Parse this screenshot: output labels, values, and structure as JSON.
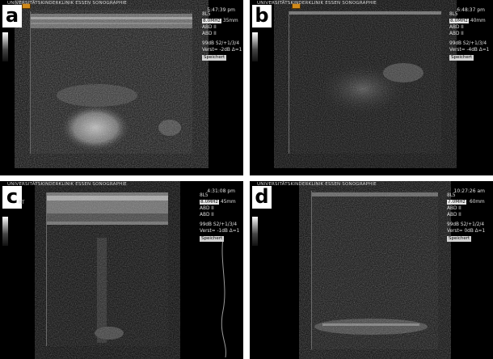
{
  "header_text": "UNIVERSITÄTSKINDERKLINIK ESSEN SONOGRAPHIE",
  "panels": [
    {
      "letter": "a",
      "time": "5:47:39 pm",
      "probe": "8L5",
      "freq": "8.0MHz",
      "depth": "35mm",
      "preset1": "ABD II",
      "preset2": "ABD II",
      "gain": "99dB",
      "s_setting": "S2/+1/3/4",
      "verst": "Verst= -2dB",
      "delta": "Δ=1",
      "saved": "Speichert"
    },
    {
      "letter": "b",
      "time": "6:48:37 pm",
      "probe": "8L5",
      "freq": "8.0MHz",
      "depth": "40mm",
      "preset1": "ABD II",
      "preset2": "ABD II",
      "gain": "99dB",
      "s_setting": "S2/+1/3/4",
      "verst": "Verst= -4dB",
      "delta": "Δ=1",
      "saved": "Speichert"
    },
    {
      "letter": "c",
      "rt": "RT",
      "time": "4:31:08 pm",
      "probe": "8L5",
      "freq": "8.0MHz",
      "depth": "45mm",
      "preset1": "ABD II",
      "preset2": "ABD II",
      "gain": "99dB",
      "s_setting": "S2/+1/3/4",
      "verst": "Verst= -1dB",
      "delta": "Δ=1",
      "saved": "Speichert"
    },
    {
      "letter": "d",
      "time": "10:27:26 am",
      "probe": "8L5",
      "freq": "7.0MHz",
      "depth": "60mm",
      "preset1": "ABD II",
      "preset2": "ABD II",
      "gain": "99dB",
      "s_setting": "S2/+1/2/4",
      "verst": "Verst= 0dB",
      "delta": "Δ=1",
      "saved": "Speichert"
    }
  ]
}
